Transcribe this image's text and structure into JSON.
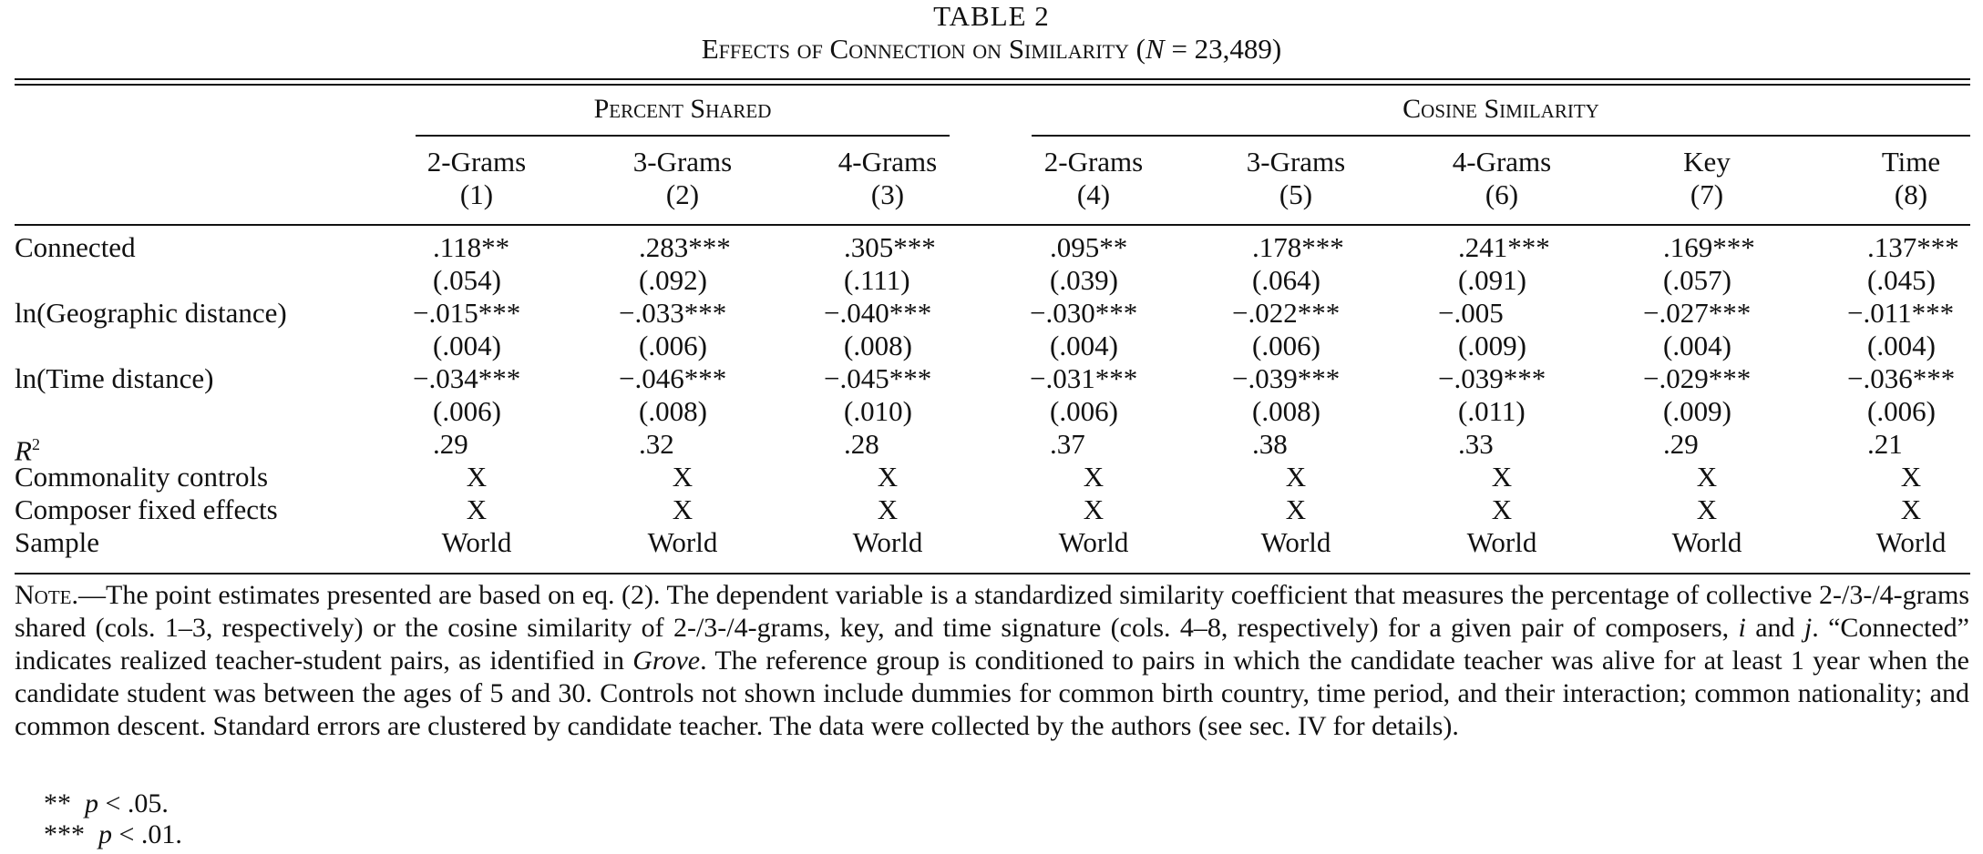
{
  "table": {
    "number": "TABLE 2",
    "title_prefix": "Effects of Connection on Similarity (",
    "title_n": "N",
    "title_suffix": " = 23,489)",
    "groups": [
      "Percent Shared",
      "Cosine Similarity"
    ],
    "columns": [
      {
        "name": "2-Grams",
        "num": "(1)"
      },
      {
        "name": "3-Grams",
        "num": "(2)"
      },
      {
        "name": "4-Grams",
        "num": "(3)"
      },
      {
        "name": "2-Grams",
        "num": "(4)"
      },
      {
        "name": "3-Grams",
        "num": "(5)"
      },
      {
        "name": "4-Grams",
        "num": "(6)"
      },
      {
        "name": "Key",
        "num": "(7)"
      },
      {
        "name": "Time",
        "num": "(8)"
      }
    ],
    "rows": [
      {
        "label": "Connected",
        "values": [
          ".118**",
          ".283***",
          ".305***",
          ".095**",
          ".178***",
          ".241***",
          ".169***",
          ".137***"
        ]
      },
      {
        "label": "",
        "values": [
          "(.054)",
          "(.092)",
          "(.111)",
          "(.039)",
          "(.064)",
          "(.091)",
          "(.057)",
          "(.045)"
        ]
      },
      {
        "label": "ln(Geographic distance)",
        "values": [
          "−.015***",
          "−.033***",
          "−.040***",
          "−.030***",
          "−.022***",
          "−.005",
          "−.027***",
          "−.011***"
        ]
      },
      {
        "label": "",
        "values": [
          "(.004)",
          "(.006)",
          "(.008)",
          "(.004)",
          "(.006)",
          "(.009)",
          "(.004)",
          "(.004)"
        ]
      },
      {
        "label": "ln(Time distance)",
        "values": [
          "−.034***",
          "−.046***",
          "−.045***",
          "−.031***",
          "−.039***",
          "−.039***",
          "−.029***",
          "−.036***"
        ]
      },
      {
        "label": "",
        "values": [
          "(.006)",
          "(.008)",
          "(.010)",
          "(.006)",
          "(.008)",
          "(.011)",
          "(.009)",
          "(.006)"
        ]
      },
      {
        "label": "R",
        "sup": "2",
        "values": [
          ".29",
          ".32",
          ".28",
          ".37",
          ".38",
          ".33",
          ".29",
          ".21"
        ]
      },
      {
        "label": "Commonality controls",
        "values": [
          "X",
          "X",
          "X",
          "X",
          "X",
          "X",
          "X",
          "X"
        ]
      },
      {
        "label": "Composer fixed effects",
        "values": [
          "X",
          "X",
          "X",
          "X",
          "X",
          "X",
          "X",
          "X"
        ]
      },
      {
        "label": "Sample",
        "values": [
          "World",
          "World",
          "World",
          "World",
          "World",
          "World",
          "World",
          "World"
        ]
      }
    ],
    "note": {
      "lead": "Note.",
      "text_1": "—The point estimates presented are based on eq. (2). The dependent variable is a standardized similarity coefficient that measures the percentage of collective 2-/3-/4-grams shared (cols. 1–3, respectively) or the cosine similarity of 2-/3-/4-grams, key, and time signature (cols. 4–8, respectively) for a given pair of composers, ",
      "i": "i",
      "and": " and ",
      "j": "j",
      "text_2": ". “Connected” indicates realized teacher-student pairs, as identified in ",
      "grove": "Grove",
      "text_3": ". The reference group is conditioned to pairs in which the candidate teacher was alive for at least 1 year when the candidate student was between the ages of 5 and 30. Controls not shown include dummies for common birth country, time period, and their interaction; common nationality; and common descent. Standard errors are clustered by candidate teacher. The data were collected by the authors (see sec. IV for details)."
    },
    "footnotes": [
      {
        "stars": "**",
        "p": "p",
        "rest": " < .05."
      },
      {
        "stars": "***",
        "p": "p",
        "rest": " < .01."
      }
    ]
  }
}
